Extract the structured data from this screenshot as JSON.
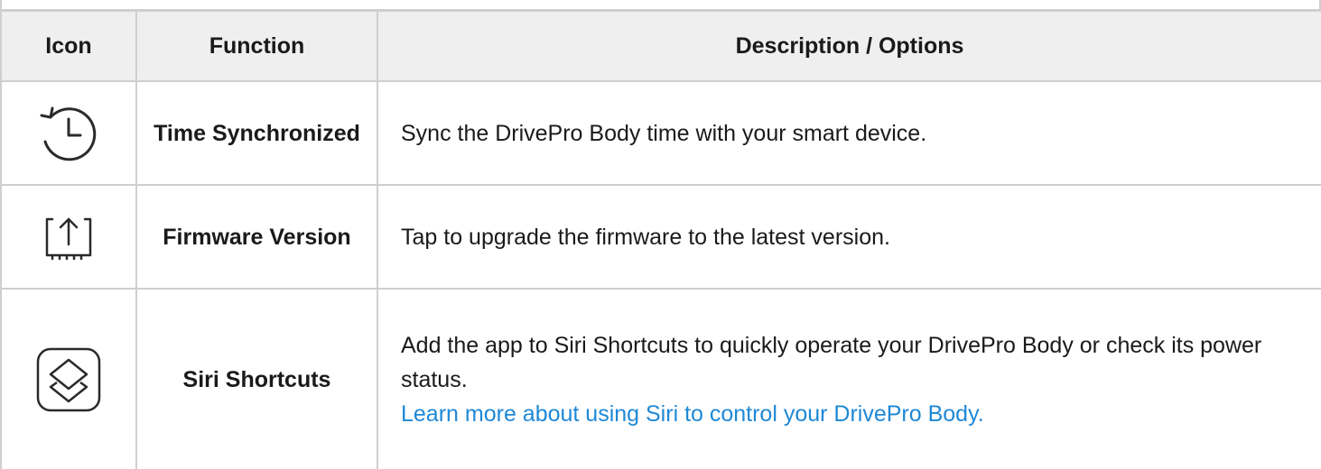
{
  "header": {
    "icon": "Icon",
    "function": "Function",
    "description": "Description / Options"
  },
  "rows": [
    {
      "icon": "history-clock-icon",
      "function": "Time Synchronized",
      "description": "Sync the DrivePro Body time with your smart device."
    },
    {
      "icon": "upload-arrow-icon",
      "function": "Firmware Version",
      "description": "Tap to upgrade the firmware to the latest version."
    },
    {
      "icon": "siri-shortcuts-icon",
      "function": "Siri Shortcuts",
      "description": "Add the app to Siri Shortcuts to quickly operate your DrivePro Body or check its power status.",
      "link": "Learn more about using Siri to control your DrivePro Body."
    }
  ],
  "colors": {
    "border": "#cfcfcf",
    "header_bg": "#efefef",
    "link": "#1e88d6"
  }
}
